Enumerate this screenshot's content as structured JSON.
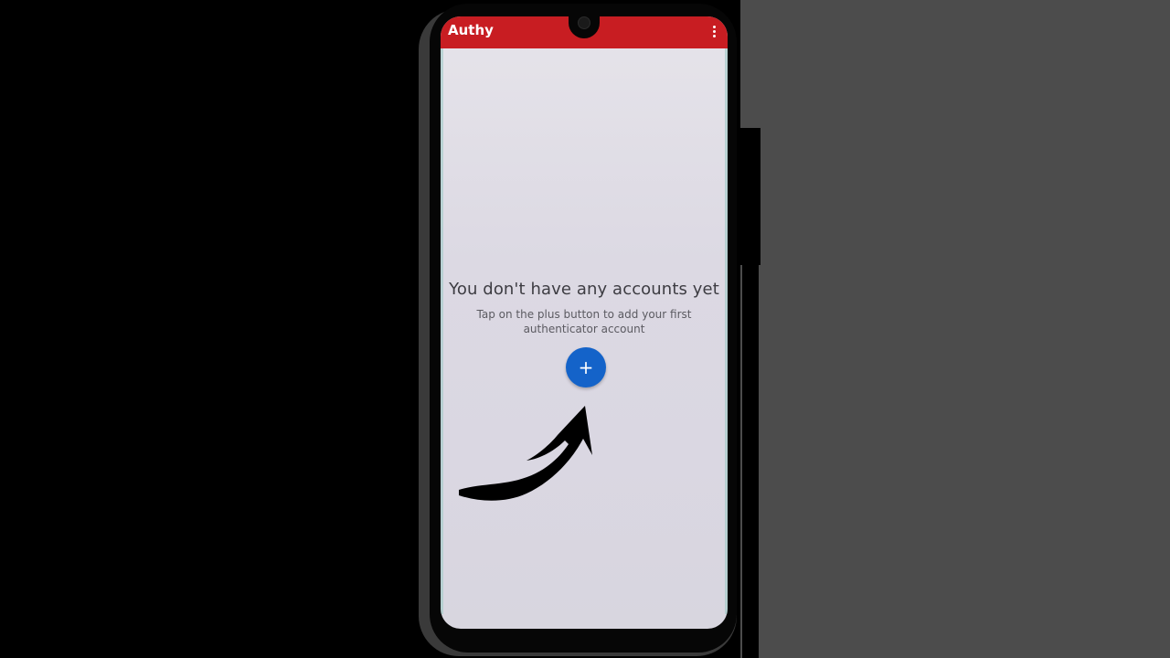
{
  "app": {
    "title": "Authy",
    "menu_icon": "more-vert-icon",
    "accent_color": "#c81d22"
  },
  "empty_state": {
    "title": "You don't have any accounts yet",
    "subtitle": "Tap on the plus button to add your first authenticator account",
    "add_button_icon": "plus-icon",
    "add_button_glyph": "+",
    "add_button_color": "#1463c9"
  },
  "annotation": {
    "icon": "curved-arrow-icon"
  }
}
